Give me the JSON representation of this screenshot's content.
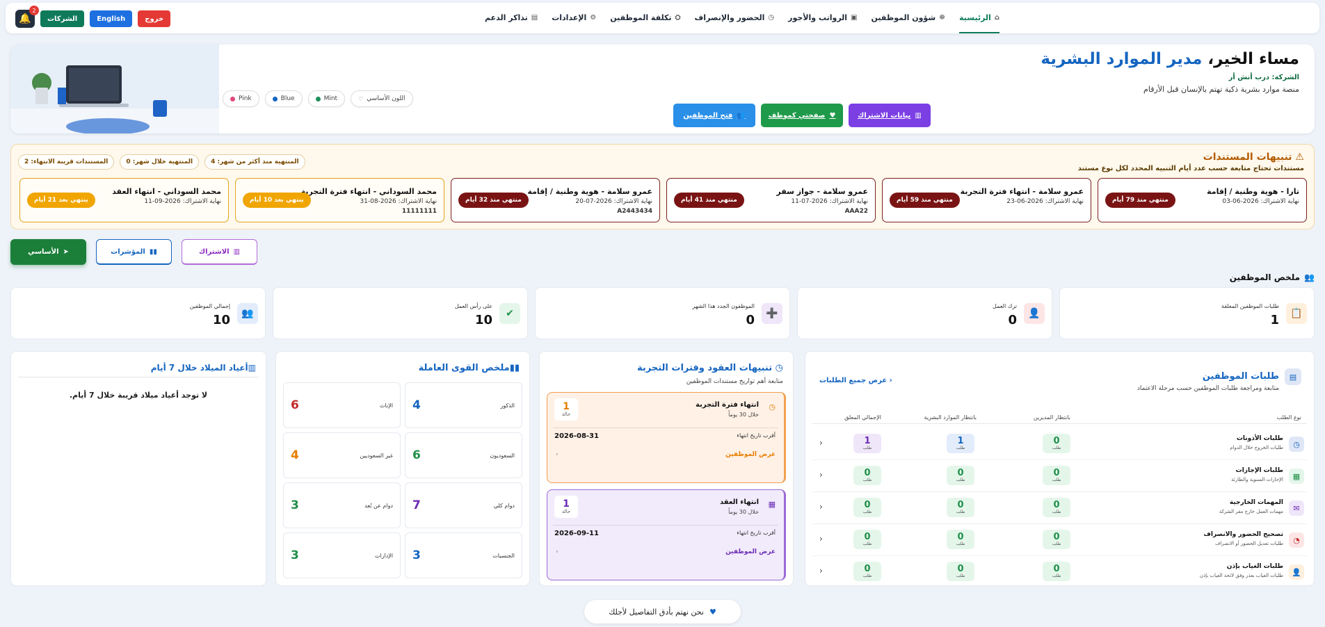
{
  "nav": {
    "items": [
      {
        "label": "الرئيسية",
        "icon": "⌂",
        "active": true
      },
      {
        "label": "شؤون الموظفين",
        "icon": "☸"
      },
      {
        "label": "الرواتب والأجور",
        "icon": "▣"
      },
      {
        "label": "الحضور والإنصراف",
        "icon": "◷"
      },
      {
        "label": "تكلفة الموظفين",
        "icon": "⛭"
      },
      {
        "label": "الإعدادات",
        "icon": "⚙"
      },
      {
        "label": "تذاكر الدعم",
        "icon": "▤"
      }
    ]
  },
  "top": {
    "notifications": "2",
    "companies": "الشركات",
    "english": "English",
    "logout": "خروج"
  },
  "hero": {
    "greeting": "مساء الخير،",
    "role": "مدير الموارد البشرية",
    "company": "الشركة: درب أنش أر",
    "tagline": "منصة موارد بشرية ذكية تهتم بالإنسان قبل الأرقام",
    "btn_subscription": "بيانات الاشتراك",
    "btn_profile": "صفحتي كموظف",
    "btn_employees": "فتح الموظفين",
    "themes": [
      {
        "label": "Pink",
        "color": "#e04a7a"
      },
      {
        "label": "Blue",
        "color": "#1565c0"
      },
      {
        "label": "Mint",
        "color": "#1f8f5a"
      },
      {
        "label": "اللون الأساسي",
        "color": ""
      }
    ]
  },
  "alerts": {
    "title": "تنبيهات المستندات",
    "subtitle": "مستندات تحتاج متابعة حسب عدد أيام التنبيه المحدد لكل نوع مستند",
    "chips": [
      "المستندات قريبة الانتهاء: 2",
      "المنتهية خلال شهر: 0",
      "المنتهية منذ أكثر من شهر: 4"
    ],
    "cards": [
      {
        "title": "تارا - هوية وطنية / إقامة",
        "date": "نهاية الاشتراك: 2026-06-03",
        "number": "",
        "badge": "منتهي منذ 79 أيام",
        "warn": false
      },
      {
        "title": "عمرو سلامة - انتهاء فترة التجربة",
        "date": "نهاية الاشتراك: 2026-06-23",
        "number": "",
        "badge": "منتهي منذ 59 أيام",
        "warn": false
      },
      {
        "title": "عمرو سلامة - جواز سفر",
        "date": "نهاية الاشتراك: 2026-07-11",
        "number": "AAA22",
        "badge": "منتهي منذ 41 أيام",
        "warn": false
      },
      {
        "title": "عمرو سلامة - هوية وطنية / إقامة",
        "date": "نهاية الاشتراك: 2026-07-20",
        "number": "A2443434",
        "badge": "منتهي منذ 32 أيام",
        "warn": false
      },
      {
        "title": "محمد السوداني - انتهاء فترة التجربة",
        "date": "نهاية الاشتراك: 2026-08-31",
        "number": "11111111",
        "badge": "ينتهي بعد 10 أيام",
        "warn": true
      },
      {
        "title": "محمد السوداني - انتهاء العقد",
        "date": "نهاية الاشتراك: 2026-09-11",
        "number": "",
        "badge": "ينتهي بعد 21 أيام",
        "warn": true
      }
    ]
  },
  "tabs": {
    "basic": "الأساسي",
    "indicators": "المؤشرات",
    "subscription": "الاشتراك"
  },
  "summary": {
    "title": "ملخص الموظفين",
    "stats": [
      {
        "label": "إجمالي الموظفين",
        "value": "10",
        "icon": "👥",
        "bg": "#e3ecfb",
        "fg": "#1565c0"
      },
      {
        "label": "على رأس العمل",
        "value": "10",
        "icon": "✔",
        "bg": "#e4f6ea",
        "fg": "#1f8f49"
      },
      {
        "label": "الموظفون الجدد هذا الشهر",
        "value": "0",
        "icon": "➕",
        "bg": "#efe6fa",
        "fg": "#6c2bb5"
      },
      {
        "label": "ترك العمل",
        "value": "0",
        "icon": "👤",
        "bg": "#fde5e5",
        "fg": "#c62828"
      },
      {
        "label": "طلبات الموظفين المعلقة",
        "value": "1",
        "icon": "📋",
        "bg": "#fff0de",
        "fg": "#e67e00"
      }
    ]
  },
  "requests": {
    "title": "طلبات الموظفين",
    "subtitle": "متابعة ومراجعة طلبات الموظفين حسب مرحلة الاعتماد",
    "view_all": "عرض جميع الطلبات",
    "headers": {
      "type": "نوع الطلب",
      "manager": "بانتظار المديرين",
      "hr": "بانتظار الموارد البشرية",
      "total": "الإجمالي المعلق"
    },
    "unit": "طلب",
    "rows": [
      {
        "name": "طلبات الأذونات",
        "desc": "طلبات الخروج خلال الدوام",
        "icon": "◷",
        "bg": "#dfe7f7",
        "fg": "#1565c0",
        "m": "0",
        "h": "1",
        "t": "1"
      },
      {
        "name": "طلبات الإجازات",
        "desc": "الإجازات السنوية والطارئة",
        "icon": "▦",
        "bg": "#e4f6ea",
        "fg": "#1f8f49",
        "m": "0",
        "h": "0",
        "t": "0"
      },
      {
        "name": "المهمات الخارجية",
        "desc": "مهمات العمل خارج مقر الشركة",
        "icon": "✉",
        "bg": "#efe6fa",
        "fg": "#6c2bb5",
        "m": "0",
        "h": "0",
        "t": "0"
      },
      {
        "name": "تصحيح الحضور والانصراف",
        "desc": "طلبات تعديل الحضور أو الانصراف",
        "icon": "◔",
        "bg": "#fde5e5",
        "fg": "#c62828",
        "m": "0",
        "h": "0",
        "t": "0"
      },
      {
        "name": "طلبات الغياب بإذن",
        "desc": "طلبات الغياب بعذر وفق لائحة الغياب بإذن",
        "icon": "👤",
        "bg": "#fff0de",
        "fg": "#e67e00",
        "m": "0",
        "h": "0",
        "t": "0"
      }
    ]
  },
  "contracts": {
    "title": "تنبيهات العقود وفترات التجربة",
    "subtitle": "متابعة أهم تواريخ مستندات الموظفين",
    "cards": [
      {
        "title": "انتهاء فترة التجربة",
        "within": "خلال 30 يوماً",
        "count": "1",
        "count_unit": "حالة",
        "nearest_label": "أقرب تاريخ انتهاء",
        "nearest": "2026-08-31",
        "link": "عرض الموظفين",
        "icon": "◷",
        "bg": "#fff1e6",
        "border": "#f0a050",
        "color": "#e67e00"
      },
      {
        "title": "انتهاء العقد",
        "within": "خلال 30 يوماً",
        "count": "1",
        "count_unit": "حالة",
        "nearest_label": "أقرب تاريخ انتهاء",
        "nearest": "2026-09-11",
        "link": "عرض الموظفين",
        "icon": "▦",
        "bg": "#f1ebfb",
        "border": "#9b6ad6",
        "color": "#6c2bb5"
      }
    ]
  },
  "workforce": {
    "title": "ملخص القوى العاملة",
    "items": [
      {
        "label": "الذكور",
        "value": "4",
        "color": "#1565c0"
      },
      {
        "label": "الإناث",
        "value": "6",
        "color": "#c62828"
      },
      {
        "label": "السعوديون",
        "value": "6",
        "color": "#1f8f49"
      },
      {
        "label": "غير السعوديين",
        "value": "4",
        "color": "#e67e00"
      },
      {
        "label": "دوام كلي",
        "value": "7",
        "color": "#6c2bb5"
      },
      {
        "label": "دوام عن بُعد",
        "value": "3",
        "color": "#1f8f49"
      },
      {
        "label": "الجنسيات",
        "value": "3",
        "color": "#1565c0"
      },
      {
        "label": "الإدارات",
        "value": "3",
        "color": "#1f8f49"
      }
    ]
  },
  "birthdays": {
    "title": "أعياد الميلاد خلال 7 أيام",
    "message": "لا توجد أعياد ميلاد قريبة خلال 7 أيام."
  },
  "footer": {
    "text": "نحن نهتم بأدق التفاصيل لأجلك"
  }
}
